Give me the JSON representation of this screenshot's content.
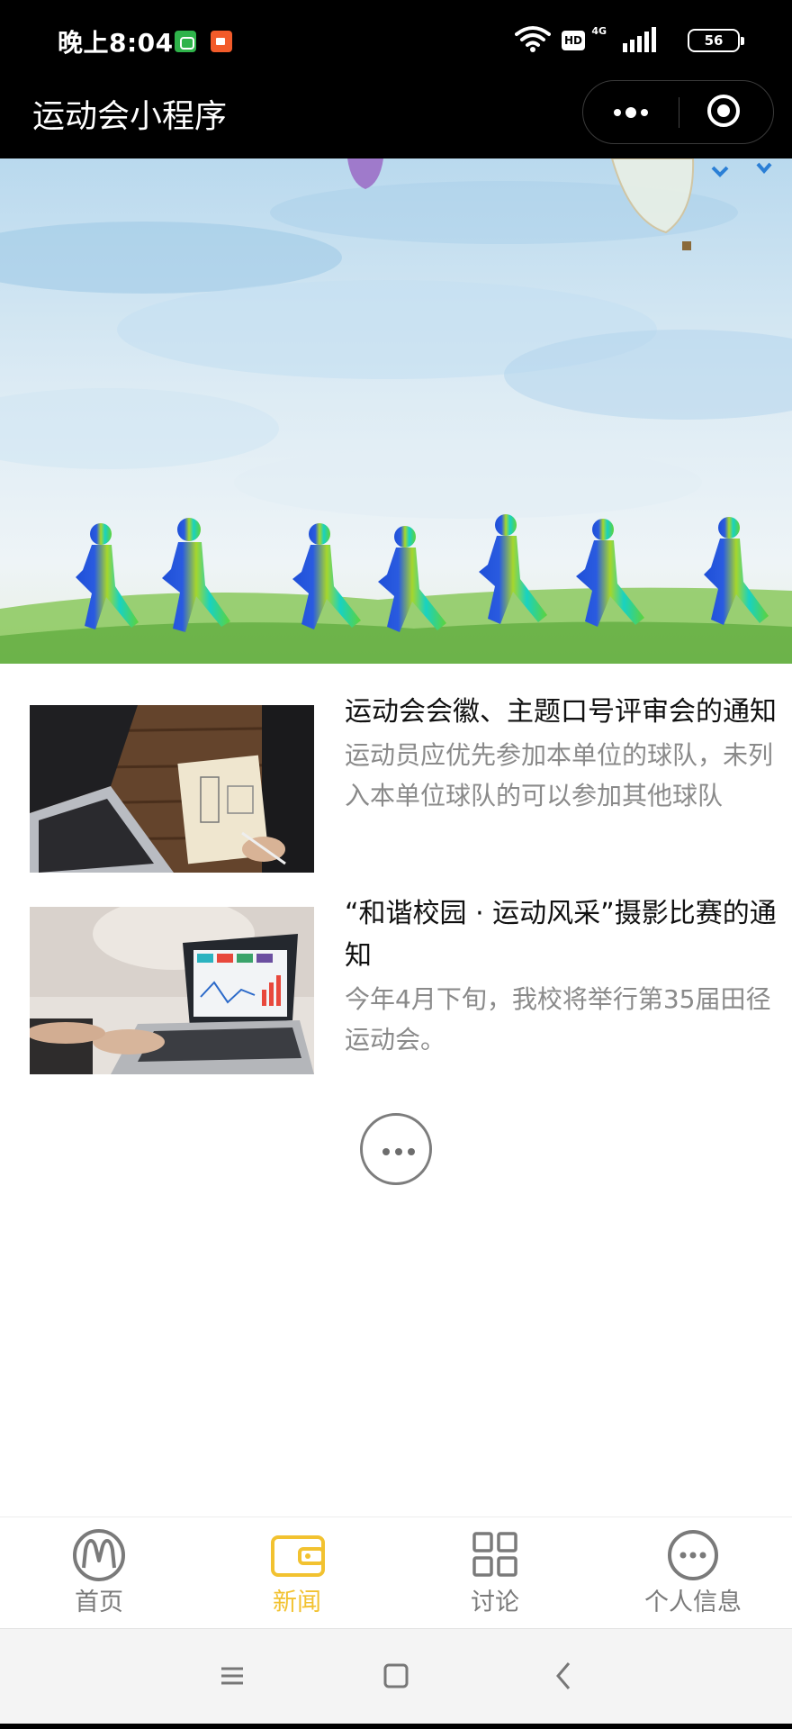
{
  "status_bar": {
    "time": "晚上8:04",
    "network": "4G",
    "hd": "HD",
    "battery": "56"
  },
  "nav": {
    "title": "运动会小程序"
  },
  "news": [
    {
      "title": "运动会会徽、主题口号评审会的通知",
      "summary": "运动员应优先参加本单位的球队，未列入本单位球队的可以参加其他球队"
    },
    {
      "title": "“和谐校园 · 运动风采”摄影比赛的通知",
      "summary": "今年4月下旬，我校将举行第35届田径运动会。"
    }
  ],
  "tabs": [
    {
      "label": "首页",
      "icon": "mcdonalds-logo-icon"
    },
    {
      "label": "新闻",
      "icon": "wallet-icon"
    },
    {
      "label": "讨论",
      "icon": "grid-icon"
    },
    {
      "label": "个人信息",
      "icon": "more-circle-icon"
    }
  ],
  "colors": {
    "active_tab": "#f2c230",
    "inactive_tab": "#7a7a7a",
    "nav_bg": "#000000"
  }
}
